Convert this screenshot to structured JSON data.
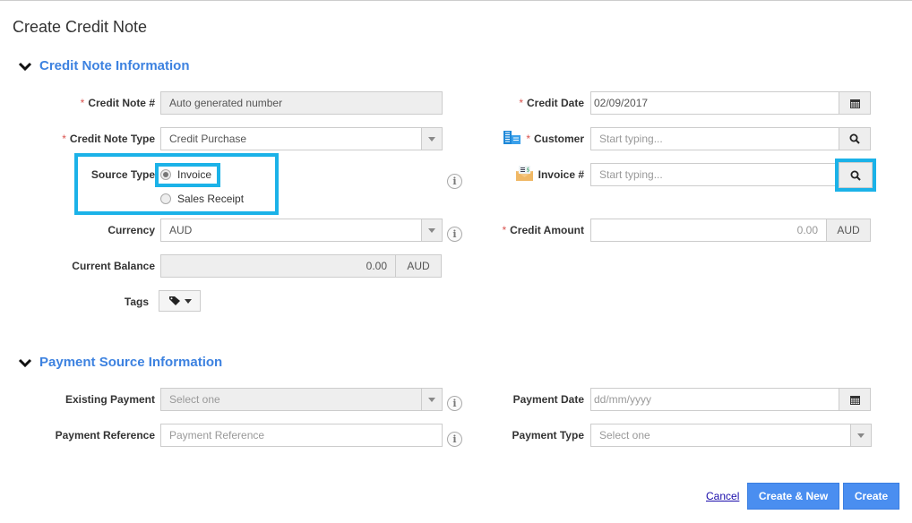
{
  "page": {
    "title": "Create Credit Note"
  },
  "sections": {
    "credit_note": {
      "title": "Credit Note Information"
    },
    "payment_source": {
      "title": "Payment Source Information"
    }
  },
  "fields": {
    "credit_note_number": {
      "label": "Credit Note #",
      "required": "*",
      "value": "Auto generated number"
    },
    "credit_note_type": {
      "label": "Credit Note Type",
      "required": "*",
      "value": "Credit Purchase"
    },
    "source_type": {
      "label": "Source Type",
      "options": [
        {
          "label": "Invoice",
          "checked": true
        },
        {
          "label": "Sales Receipt",
          "checked": false
        }
      ]
    },
    "currency": {
      "label": "Currency",
      "value": "AUD"
    },
    "current_balance": {
      "label": "Current Balance",
      "value": "0.00",
      "unit": "AUD"
    },
    "tags": {
      "label": "Tags"
    },
    "credit_date": {
      "label": "Credit Date",
      "required": "*",
      "value": "02/09/2017"
    },
    "customer": {
      "label": "Customer",
      "required": "*",
      "placeholder": "Start typing..."
    },
    "invoice_number": {
      "label": "Invoice #",
      "placeholder": "Start typing..."
    },
    "credit_amount": {
      "label": "Credit Amount",
      "required": "*",
      "value": "0.00",
      "unit": "AUD"
    },
    "existing_payment": {
      "label": "Existing Payment",
      "placeholder": "Select one"
    },
    "payment_reference": {
      "label": "Payment Reference",
      "placeholder": "Payment Reference"
    },
    "payment_date": {
      "label": "Payment Date",
      "placeholder": "dd/mm/yyyy"
    },
    "payment_type": {
      "label": "Payment Type",
      "placeholder": "Select one"
    }
  },
  "actions": {
    "cancel": "Cancel",
    "create_new": "Create & New",
    "create": "Create"
  },
  "colors": {
    "accent": "#3d82e0",
    "highlight": "#1bb2e8",
    "button": "#4a8ef0",
    "required": "#d9534f"
  }
}
